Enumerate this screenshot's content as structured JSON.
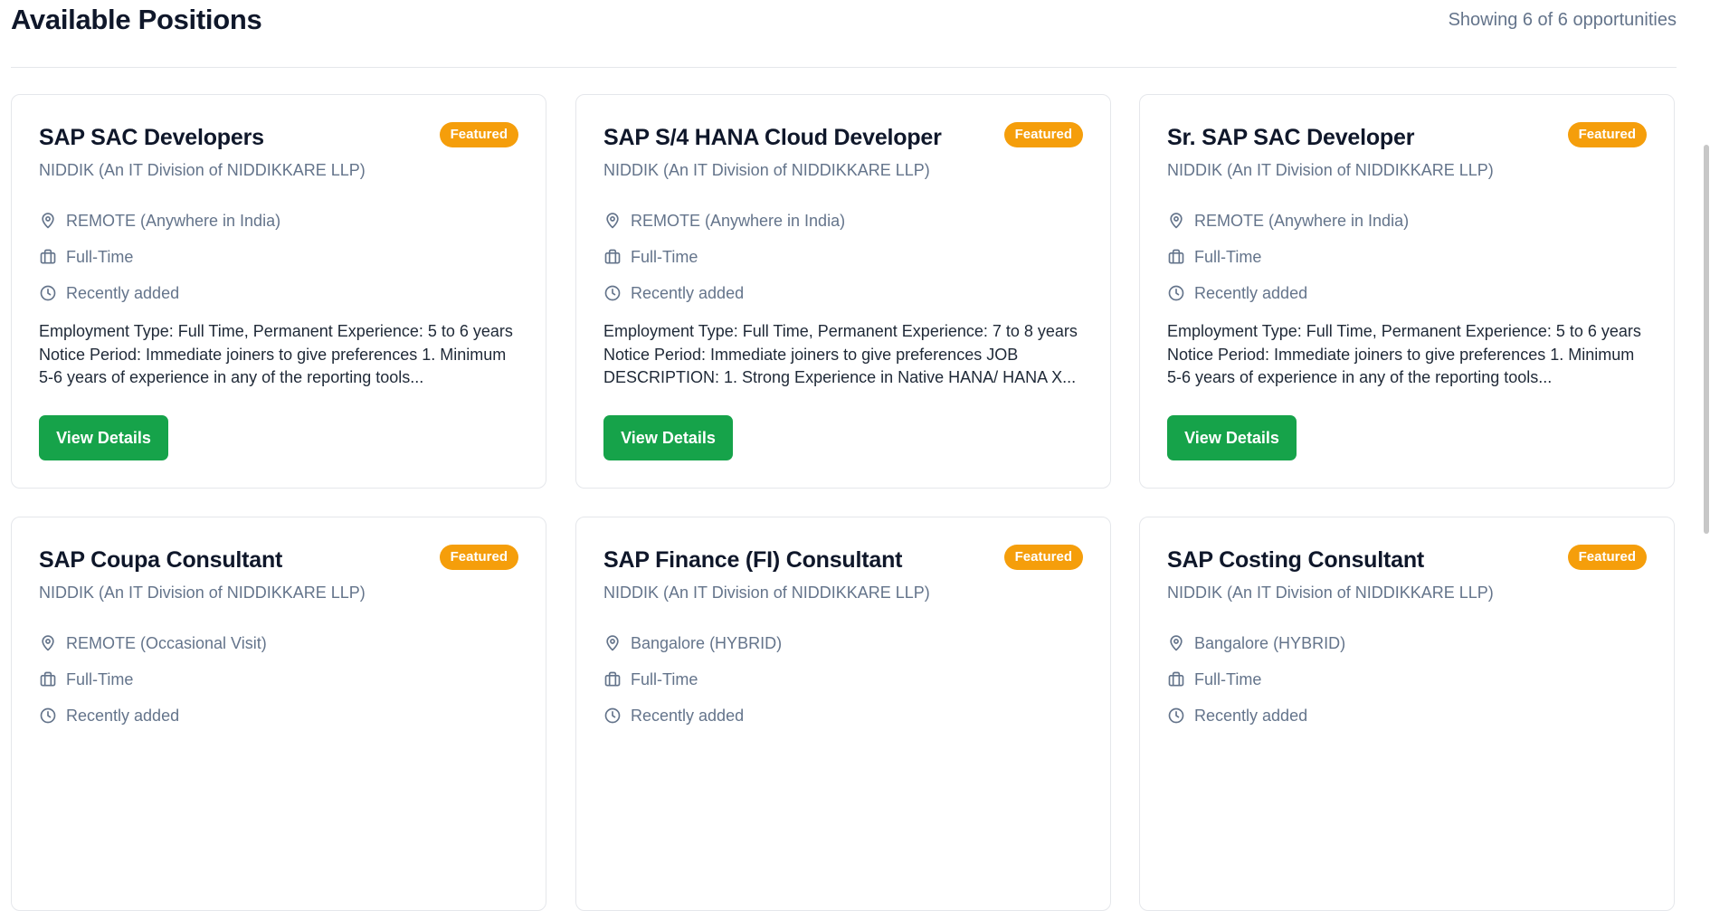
{
  "header": {
    "title": "Available Positions",
    "showing": "Showing 6 of 6 opportunities"
  },
  "colors": {
    "accent_green": "#16a34a",
    "badge_orange": "#f59e0b",
    "muted_text": "#64748b"
  },
  "icons": {
    "location": "location-pin-icon",
    "job_type": "briefcase-icon",
    "time": "clock-icon"
  },
  "jobs": [
    {
      "title": "SAP SAC Developers",
      "badge": "Featured",
      "company": "NIDDIK (An IT Division of NIDDIKKARE LLP)",
      "location": "REMOTE (Anywhere in India)",
      "type": "Full-Time",
      "posted": "Recently added",
      "description": "Employment Type: Full Time, Permanent Experience: 5 to 6 years Notice Period: Immediate joiners to give preferences 1. Minimum 5-6 years of experience in any of the reporting tools...",
      "button": "View Details"
    },
    {
      "title": "SAP S/4 HANA Cloud Developer",
      "badge": "Featured",
      "company": "NIDDIK (An IT Division of NIDDIKKARE LLP)",
      "location": "REMOTE (Anywhere in India)",
      "type": "Full-Time",
      "posted": "Recently added",
      "description": "Employment Type: Full Time, Permanent Experience: 7 to 8 years Notice Period: Immediate joiners to give preferences JOB DESCRIPTION: 1. Strong Experience in Native HANA/ HANA X...",
      "button": "View Details"
    },
    {
      "title": "Sr. SAP SAC Developer",
      "badge": "Featured",
      "company": "NIDDIK (An IT Division of NIDDIKKARE LLP)",
      "location": "REMOTE (Anywhere in India)",
      "type": "Full-Time",
      "posted": "Recently added",
      "description": "Employment Type: Full Time, Permanent Experience: 5 to 6 years Notice Period: Immediate joiners to give preferences 1. Minimum 5-6 years of experience in any of the reporting tools...",
      "button": "View Details"
    },
    {
      "title": "SAP Coupa Consultant",
      "badge": "Featured",
      "company": "NIDDIK (An IT Division of NIDDIKKARE LLP)",
      "location": "REMOTE (Occasional Visit)",
      "type": "Full-Time",
      "posted": "Recently added"
    },
    {
      "title": "SAP Finance (FI) Consultant",
      "badge": "Featured",
      "company": "NIDDIK (An IT Division of NIDDIKKARE LLP)",
      "location": "Bangalore (HYBRID)",
      "type": "Full-Time",
      "posted": "Recently added"
    },
    {
      "title": "SAP Costing Consultant",
      "badge": "Featured",
      "company": "NIDDIK (An IT Division of NIDDIKKARE LLP)",
      "location": "Bangalore (HYBRID)",
      "type": "Full-Time",
      "posted": "Recently added"
    }
  ]
}
